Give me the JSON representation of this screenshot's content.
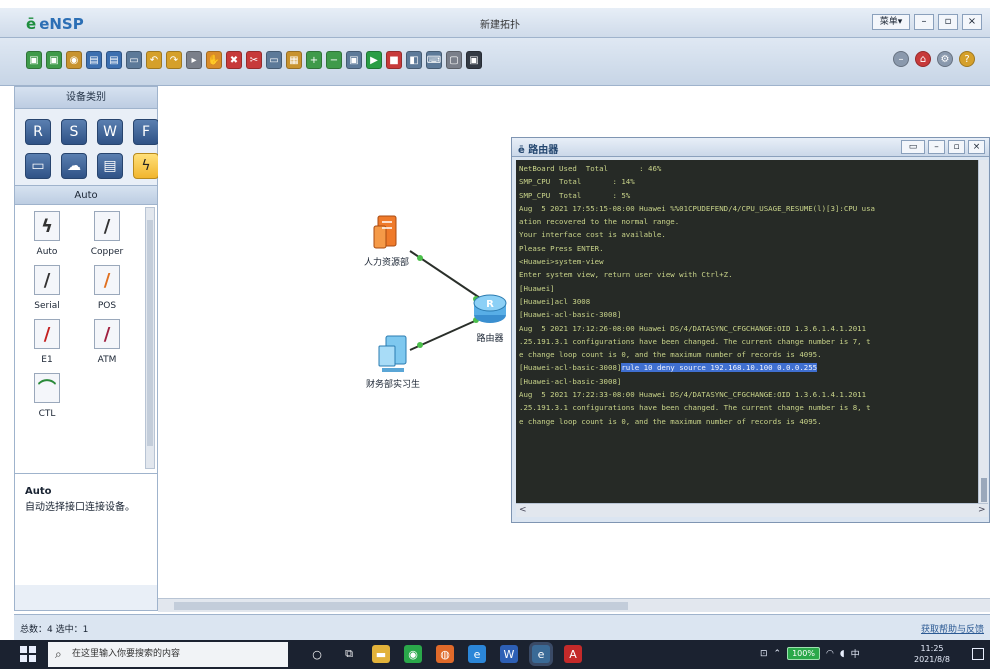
{
  "app": {
    "logo": "eNSP",
    "window_title": "新建拓扑",
    "menu_label": "菜单▾",
    "buttons": {
      "minimize": "–",
      "maximize": "▫",
      "close": "×"
    }
  },
  "toolbar": {
    "icons": [
      {
        "name": "new-topology-icon",
        "glyph": "▣",
        "color": "#3f9a4a"
      },
      {
        "name": "open-topology-icon",
        "glyph": "▣",
        "color": "#3f9a4a"
      },
      {
        "name": "open-example-icon",
        "glyph": "◉",
        "color": "#c8932f"
      },
      {
        "name": "save-icon",
        "glyph": "▤",
        "color": "#3c6fb0"
      },
      {
        "name": "save-as-icon",
        "glyph": "▤",
        "color": "#3c6fb0"
      },
      {
        "name": "print-icon",
        "glyph": "▭",
        "color": "#5d7a99"
      },
      {
        "name": "undo-icon",
        "glyph": "↶",
        "color": "#d5a02b"
      },
      {
        "name": "redo-icon",
        "glyph": "↷",
        "color": "#d5a02b"
      },
      {
        "name": "select-icon",
        "glyph": "▸",
        "color": "#7a7f8a"
      },
      {
        "name": "drag-icon",
        "glyph": "✋",
        "color": "#d98c2b"
      },
      {
        "name": "delete-icon",
        "glyph": "✖",
        "color": "#c73a3a"
      },
      {
        "name": "delete-link-icon",
        "glyph": "✂",
        "color": "#c73a3a"
      },
      {
        "name": "text-icon",
        "glyph": "▭",
        "color": "#5d7a99"
      },
      {
        "name": "palette-icon",
        "glyph": "▦",
        "color": "#c8932f"
      },
      {
        "name": "zoom-in-icon",
        "glyph": "+",
        "color": "#3f9a4a"
      },
      {
        "name": "zoom-out-icon",
        "glyph": "−",
        "color": "#3f9a4a"
      },
      {
        "name": "fit-icon",
        "glyph": "▣",
        "color": "#5d7a99"
      },
      {
        "name": "start-icon",
        "glyph": "▶",
        "color": "#2a9d45"
      },
      {
        "name": "stop-icon",
        "glyph": "■",
        "color": "#c73a3a"
      },
      {
        "name": "capture-icon",
        "glyph": "◧",
        "color": "#5d7a99"
      },
      {
        "name": "cli-icon",
        "glyph": "⌨",
        "color": "#5d7a99"
      },
      {
        "name": "topology-icon",
        "glyph": "▢",
        "color": "#7a7f8a"
      },
      {
        "name": "screenshot-icon",
        "glyph": "▣",
        "color": "#333a44"
      }
    ],
    "right_icons": [
      {
        "name": "minimize-panel-icon",
        "glyph": "–",
        "color": "#8a99ad"
      },
      {
        "name": "home-icon",
        "glyph": "⌂",
        "color": "#c73a3a"
      },
      {
        "name": "settings-icon",
        "glyph": "⚙",
        "color": "#8a99ad"
      },
      {
        "name": "help-icon",
        "glyph": "?",
        "color": "#d5a02b"
      }
    ]
  },
  "sidebar": {
    "title": "设备类别",
    "devices": [
      {
        "name": "router-category-icon",
        "glyph": "R"
      },
      {
        "name": "switch-category-icon",
        "glyph": "S"
      },
      {
        "name": "wlan-category-icon",
        "glyph": "W"
      },
      {
        "name": "firewall-category-icon",
        "glyph": "F"
      },
      {
        "name": "terminal-category-icon",
        "glyph": "▭"
      },
      {
        "name": "cloud-category-icon",
        "glyph": "☁"
      },
      {
        "name": "other-device-category-icon",
        "glyph": "▤"
      },
      {
        "name": "connection-category-icon",
        "glyph": "ϟ"
      }
    ],
    "sub_title": "Auto",
    "cables": [
      {
        "label": "Auto",
        "color": "#333333",
        "glyph": "ϟ"
      },
      {
        "label": "Copper",
        "color": "#333333",
        "glyph": "/"
      },
      {
        "label": "Serial",
        "color": "#333333",
        "glyph": "/"
      },
      {
        "label": "POS",
        "color": "#e07020",
        "glyph": "/"
      },
      {
        "label": "E1",
        "color": "#c42020",
        "glyph": "/"
      },
      {
        "label": "ATM",
        "color": "#a02040",
        "glyph": "/"
      },
      {
        "label": "CTL",
        "color": "#2a8a3a",
        "glyph": "⌒"
      }
    ],
    "description_title": "Auto",
    "description_text": "自动选择接口连接设备。"
  },
  "canvas": {
    "nodes": [
      {
        "label": "人力资源部",
        "type": "server"
      },
      {
        "label": "财务部实习生",
        "type": "pc"
      },
      {
        "label": "路由器",
        "type": "router"
      }
    ]
  },
  "console": {
    "title": "路由器",
    "lines": [
      {
        "text": "NetBoard Used  Total       : 46%",
        "hl": ""
      },
      {
        "text": "SMP_CPU  Total       : 14%",
        "hl": ""
      },
      {
        "text": "SMP_CPU  Total       : 5%",
        "hl": ""
      },
      {
        "text": "Aug  5 2021 17:55:15-08:00 Huawei %%01CPUDEFEND/4/CPU_USAGE_RESUME(l)[3]:CPU usa",
        "hl": ""
      },
      {
        "text": "ation recovered to the normal range.",
        "hl": ""
      },
      {
        "text": "",
        "hl": ""
      },
      {
        "text": "Your interface cost is available.",
        "hl": ""
      },
      {
        "text": "",
        "hl": ""
      },
      {
        "text": "",
        "hl": ""
      },
      {
        "text": "",
        "hl": ""
      },
      {
        "text": "Please Press ENTER.",
        "hl": ""
      },
      {
        "text": "",
        "hl": ""
      },
      {
        "text": "<Huawei>system-view",
        "hl": ""
      },
      {
        "text": "Enter system view, return user view with Ctrl+Z.",
        "hl": ""
      },
      {
        "text": "[Huawei]",
        "hl": ""
      },
      {
        "text": "[Huawei]acl 3008",
        "hl": ""
      },
      {
        "text": "[Huawei-acl-basic-3008]",
        "hl": ""
      },
      {
        "text": "Aug  5 2021 17:12:26-08:00 Huawei DS/4/DATASYNC_CFGCHANGE:OID 1.3.6.1.4.1.2011",
        "hl": ""
      },
      {
        "text": ".25.191.3.1 configurations have been changed. The current change number is 7, t",
        "hl": ""
      },
      {
        "text": "e change loop count is 0, and the maximum number of records is 4095.",
        "hl": ""
      },
      {
        "text": "[Huawei-acl-basic-3008]",
        "hl": "rule 10 deny source 192.168.10.100 0.0.0.255"
      },
      {
        "text": "[Huawei-acl-basic-3008]",
        "hl": ""
      },
      {
        "text": "Aug  5 2021 17:22:33-08:00 Huawei DS/4/DATASYNC_CFGCHANGE:OID 1.3.6.1.4.1.2011",
        "hl": ""
      },
      {
        "text": ".25.191.3.1 configurations have been changed. The current change number is 8, t",
        "hl": ""
      },
      {
        "text": "e change loop count is 0, and the maximum number of records is 4095.",
        "hl": ""
      }
    ]
  },
  "statusbar": {
    "left_text": "总数：4  选中：1",
    "right_text": "获取帮助与反馈"
  },
  "taskbar": {
    "search_placeholder": "在这里输入你要搜索的内容",
    "apps": [
      {
        "name": "cortana-icon",
        "glyph": "○",
        "color": "#1b2230"
      },
      {
        "name": "task-view-icon",
        "glyph": "⧉",
        "color": "#1b2230"
      },
      {
        "name": "file-explorer-icon",
        "glyph": "▬",
        "color": "#e2b23a"
      },
      {
        "name": "wechat-icon",
        "glyph": "◉",
        "color": "#2aa84a"
      },
      {
        "name": "browser-icon",
        "glyph": "◍",
        "color": "#e06a2a"
      },
      {
        "name": "edge-icon",
        "glyph": "e",
        "color": "#2b86d8"
      },
      {
        "name": "word-icon",
        "glyph": "W",
        "color": "#2d5fb5"
      },
      {
        "name": "ensp-task-icon",
        "glyph": "e",
        "color": "#3a6a96"
      },
      {
        "name": "pdf-icon",
        "glyph": "A",
        "color": "#c42a2a"
      }
    ],
    "tray_battery": "100%",
    "tray_lang": "中",
    "time": "11:25",
    "date": "2021/8/8"
  }
}
